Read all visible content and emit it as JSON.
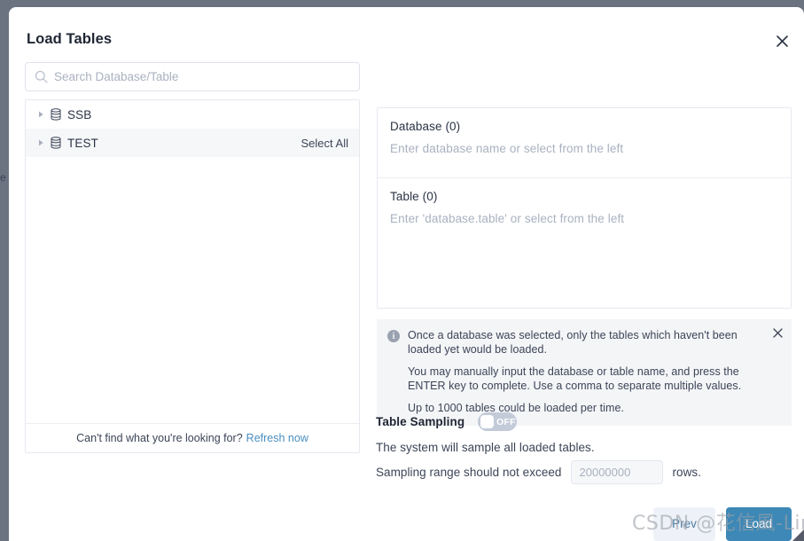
{
  "background": {
    "edge_text": "e",
    "overlay_color": "#6b7280"
  },
  "modal": {
    "title": "Load Tables",
    "close_icon": "close-icon"
  },
  "search": {
    "icon": "search-icon",
    "placeholder": "Search Database/Table",
    "value": ""
  },
  "tree": {
    "items": [
      {
        "label": "SSB",
        "icon": "database-icon",
        "expander": "chevron-right-icon",
        "hovered": false,
        "select_all": ""
      },
      {
        "label": "TEST",
        "icon": "database-icon",
        "expander": "chevron-right-icon",
        "hovered": true,
        "select_all": "Select All"
      }
    ],
    "footer_text": "Can't find what you're looking for?",
    "footer_link": "Refresh now"
  },
  "selection": {
    "database": {
      "title": "Database (0)",
      "placeholder": "Enter database name or select from the left"
    },
    "table": {
      "title": "Table (0)",
      "placeholder": "Enter 'database.table' or select from the left"
    }
  },
  "notice": {
    "icon": "info-icon",
    "close_icon": "close-icon",
    "line1": "Once a database was selected, only the tables which haven't been loaded yet would be loaded.",
    "line2": "You may manually input the database or table name, and press the ENTER key to complete. Use a comma to separate multiple values.",
    "line3": "Up to 1000 tables could be loaded per time."
  },
  "sampling": {
    "title": "Table Sampling",
    "toggle_state": "OFF",
    "description": "The system will sample all loaded tables.",
    "range_prefix": "Sampling range should not exceed",
    "range_placeholder": "20000000",
    "range_value": "",
    "range_suffix": "rows."
  },
  "footer": {
    "prev_label": "Prev",
    "load_label": "Load",
    "load_color": "#3d88b6",
    "prev_color": "#eef2f8"
  },
  "watermark": {
    "text": "CSDN @花信風-Ling"
  }
}
